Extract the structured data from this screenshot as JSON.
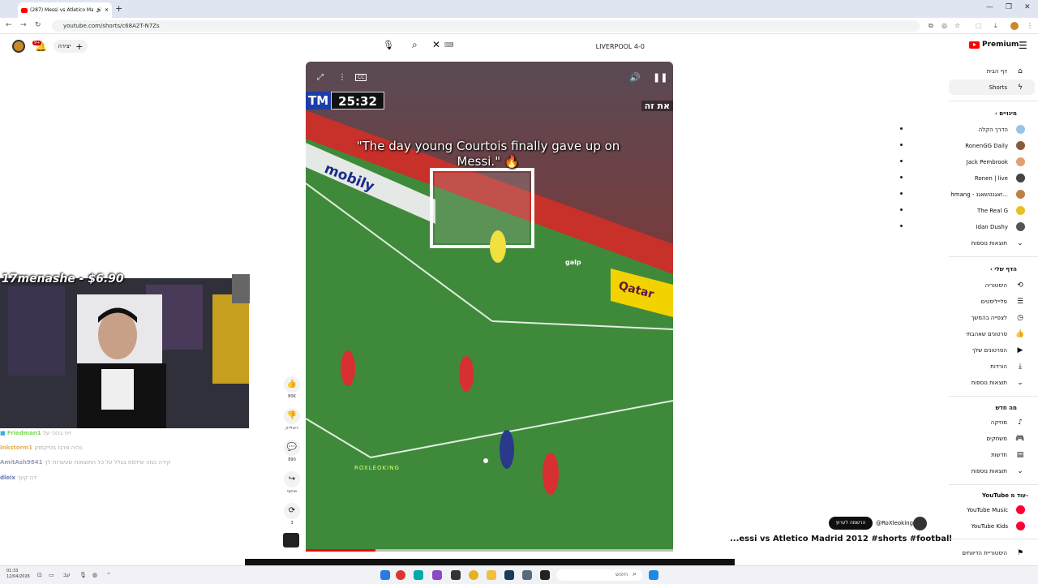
{
  "browser": {
    "tab_title": "(287) Messi vs Atletico Ma...",
    "url": "youtube.com/shorts/c68A2T-N7Zs"
  },
  "header": {
    "notification_count": "9+",
    "create_label": "יצירה",
    "search_value": "LIVERPOOL 4-0",
    "logo_text": "Premium"
  },
  "video": {
    "clock_brand": "TM",
    "clock_time": "25:32",
    "overlay_tag": "את זה",
    "caption": "\"The day young Courtois finally gave up on Messi.\" 🔥",
    "watermark": "ROXLEOKING",
    "progress": 0.19,
    "ad_texts": [
      "mobily",
      "galp",
      "Qatar"
    ],
    "cc_label": "CC"
  },
  "actions": {
    "like_count": "80K",
    "dislike_label": "דיסלייק",
    "comment_count": "890",
    "share_label": "שיתוף",
    "remix_count": "3"
  },
  "channel": {
    "subscribe_label": "הרשמה לערוץ",
    "name": "@RoXleoking",
    "title": "...essi vs Atletico Madrid 2012 #shorts #football"
  },
  "webcam": {
    "name_overlay": "17menashe - $6.90"
  },
  "chat": [
    {
      "user": "Friedman1",
      "msg": "זיני בהכי על"
    },
    {
      "user": "Inkstorm1",
      "msg": "נהיה מרגז בטיקמוק"
    },
    {
      "user": "AmitAsh9841",
      "msg": "קירה כמה שילמת בגלל על כל התוצאות שעשרות לך"
    },
    {
      "user": "dleix",
      "msg": "דה קעך"
    }
  ],
  "sidebar": {
    "home": "דף הבית",
    "shorts": "Shorts",
    "subscriptions_header": "מינויים",
    "subscriptions": [
      {
        "name": "הדרך הקלה",
        "color": "#9ac4e6"
      },
      {
        "name": "RonenGG Daily",
        "color": "#8a5a3c"
      },
      {
        "name": "Jack Pembrook",
        "color": "#e0a070"
      },
      {
        "name": "Ronen | live",
        "color": "#444444"
      },
      {
        "name": "hmang - זאגנטשאגנ...",
        "color": "#c08040"
      },
      {
        "name": "The Real G",
        "color": "#e8c020"
      },
      {
        "name": "Idan Dushy",
        "color": "#555555"
      }
    ],
    "show_more_1": "תוצאות נוספות",
    "you_header": "הדף שלי",
    "you_items": [
      {
        "label": "היסטוריה",
        "icon": "history-icon",
        "glyph": "⟲"
      },
      {
        "label": "פלייליסטים",
        "icon": "playlist-icon",
        "glyph": "☰"
      },
      {
        "label": "לצפייה בהמשך",
        "icon": "clock-icon",
        "glyph": "◷"
      },
      {
        "label": "סרטונים שאהבתי",
        "icon": "thumb-up-icon",
        "glyph": "👍"
      },
      {
        "label": "הסרטונים שלך",
        "icon": "play-box-icon",
        "glyph": "▶"
      },
      {
        "label": "הורדות",
        "icon": "download-icon",
        "glyph": "⤓"
      }
    ],
    "show_more_2": "תוצאות נוספות",
    "explore_header": "מה חדש",
    "explore_items": [
      {
        "label": "מוזיקה",
        "icon": "music-icon",
        "glyph": "♪"
      },
      {
        "label": "משחקים",
        "icon": "gamepad-icon",
        "glyph": "🎮"
      },
      {
        "label": "חדשות",
        "icon": "news-icon",
        "glyph": "▤"
      }
    ],
    "show_more_3": "תוצאות נוספות",
    "more_header": "YouTube עוד מ-",
    "more_items": [
      {
        "label": "YouTube Music",
        "color": "#ff0033"
      },
      {
        "label": "YouTube Kids",
        "color": "#ff0033"
      }
    ],
    "report_history": "היסטוריית הדיווחים"
  },
  "taskbar": {
    "time": "01:33",
    "date": "12/04/2026",
    "lang": "עב",
    "search_placeholder": "חיפוש"
  },
  "colors": {
    "accent": "#ff0000",
    "pitch": "#3f8a3a",
    "stands": "#5a3a3a"
  }
}
